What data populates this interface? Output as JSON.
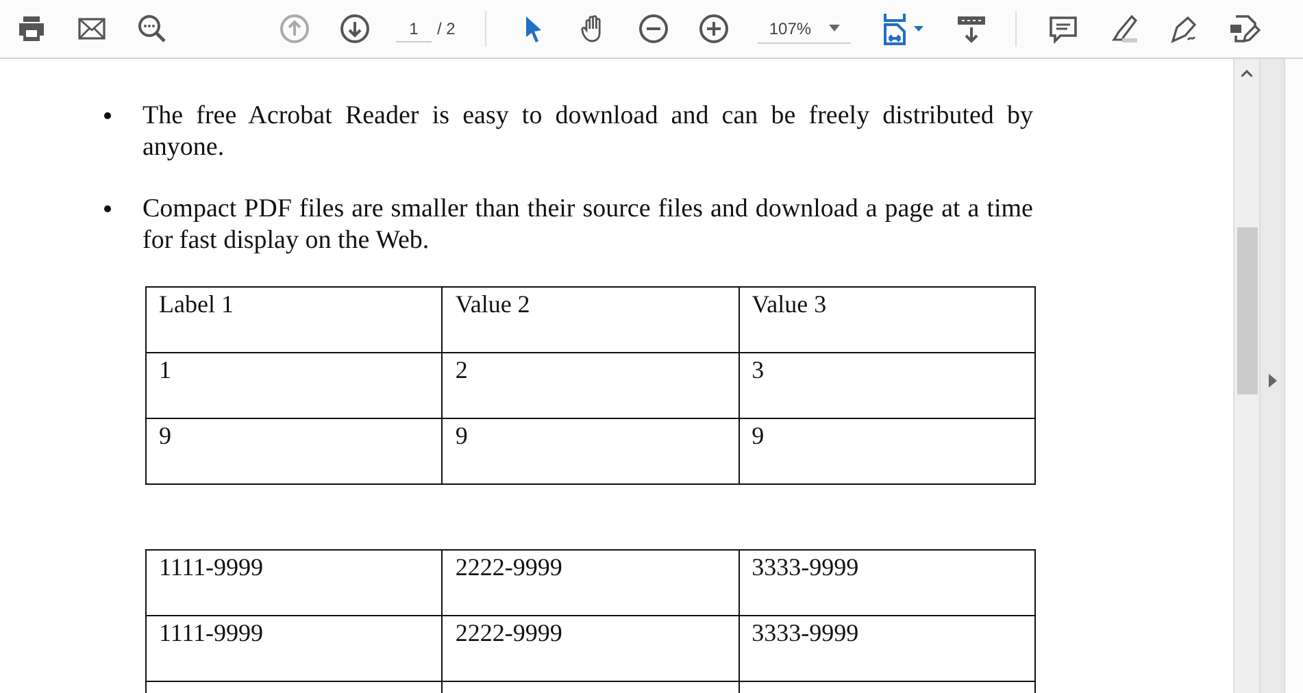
{
  "toolbar": {
    "page_current": "1",
    "page_total": "/ 2",
    "zoom": "107%"
  },
  "document": {
    "bullets": [
      "The free Acrobat Reader is easy to download and can be freely distributed by anyone.",
      "Compact PDF files are smaller than their source files and download a page at a time for fast display on the Web."
    ],
    "tables": [
      {
        "rows": [
          [
            "Label 1",
            "Value 2",
            "Value 3"
          ],
          [
            "1",
            "2",
            "3"
          ],
          [
            "9",
            "9",
            "9"
          ]
        ]
      },
      {
        "rows": [
          [
            "1111-9999",
            "2222-9999",
            "3333-9999"
          ],
          [
            "1111-9999",
            "2222-9999",
            "3333-9999"
          ]
        ]
      }
    ]
  }
}
